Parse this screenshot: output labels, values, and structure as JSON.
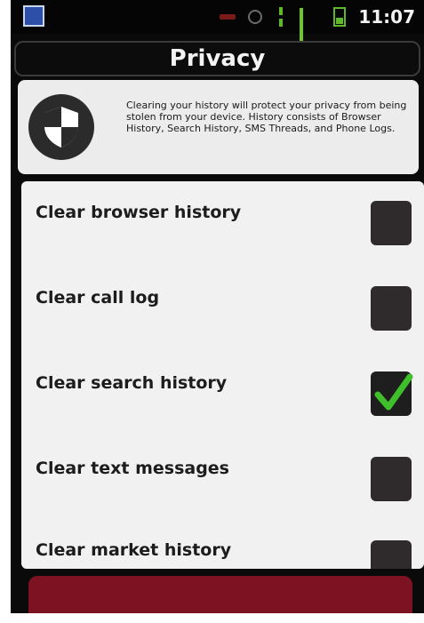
{
  "status_bar": {
    "time": "11:07",
    "icons": [
      "app-notification-icon",
      "battery-low-icon",
      "sync-icon",
      "data-transfer-icon",
      "signal-icon",
      "battery-icon"
    ]
  },
  "header": {
    "title": "Privacy"
  },
  "info": {
    "icon": "shield-icon",
    "text": "Clearing your history will protect your privacy from being stolen from your device. History consists of Browser History, Search History, SMS Threads, and Phone Logs."
  },
  "options": [
    {
      "label": "Clear browser history",
      "checked": false
    },
    {
      "label": "Clear call log",
      "checked": false
    },
    {
      "label": "Clear search history",
      "checked": true
    },
    {
      "label": "Clear text messages",
      "checked": false
    },
    {
      "label": "Clear market history",
      "checked": false
    }
  ],
  "colors": {
    "checkmark": "#3fbf2a",
    "button": "#7d1222"
  }
}
